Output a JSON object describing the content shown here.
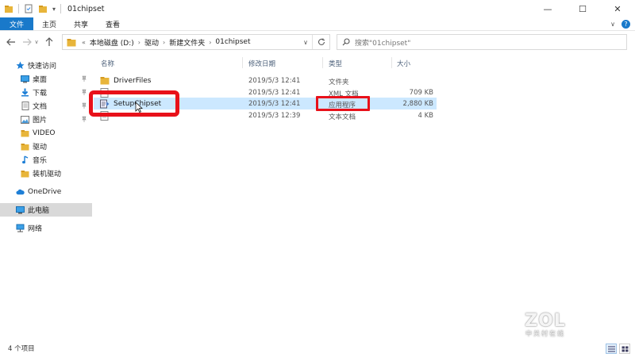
{
  "window": {
    "title": "01chipset",
    "controls": {
      "minimize": "—",
      "maximize": "☐",
      "close": "✕"
    }
  },
  "ribbon": {
    "tabs": [
      "文件",
      "主页",
      "共享",
      "查看"
    ]
  },
  "address": {
    "prefix": "«",
    "crumbs": [
      "本地磁盘 (D:)",
      "驱动",
      "新建文件夹",
      "01chipset"
    ],
    "search_placeholder": "搜索\"01chipset\""
  },
  "sidebar": {
    "quick_access": "快速访问",
    "quick_items": [
      {
        "label": "桌面",
        "pinned": true
      },
      {
        "label": "下载",
        "pinned": true
      },
      {
        "label": "文档",
        "pinned": true
      },
      {
        "label": "图片",
        "pinned": true
      },
      {
        "label": "VIDEO",
        "pinned": false
      },
      {
        "label": "驱动",
        "pinned": false
      },
      {
        "label": "音乐",
        "pinned": false
      },
      {
        "label": "装机驱动",
        "pinned": false
      }
    ],
    "onedrive": "OneDrive",
    "this_pc": "此电脑",
    "network": "网络"
  },
  "columns": {
    "name": "名称",
    "date": "修改日期",
    "type": "类型",
    "size": "大小"
  },
  "files": [
    {
      "name": "DriverFiles",
      "date": "2019/5/3 12:41",
      "type": "文件夹",
      "size": "",
      "icon": "folder-icon"
    },
    {
      "name": "",
      "date": "2019/5/3 12:41",
      "type": "XML 文档",
      "size": "709 KB",
      "icon": "xml-file-icon"
    },
    {
      "name": "SetupChipset",
      "date": "2019/5/3 12:41",
      "type": "应用程序",
      "size": "2,880 KB",
      "icon": "setup-exe-icon"
    },
    {
      "name": "",
      "date": "2019/5/3 12:39",
      "type": "文本文档",
      "size": "4 KB",
      "icon": "text-file-icon"
    }
  ],
  "status": {
    "count": "4 个项目"
  },
  "watermark": {
    "logo": "ZOL",
    "tagline": "中关村在线"
  },
  "colors": {
    "accent": "#1979ca",
    "selected_row": "#cce8ff",
    "annotation": "#e8111a",
    "folder": "#e8b53a"
  }
}
